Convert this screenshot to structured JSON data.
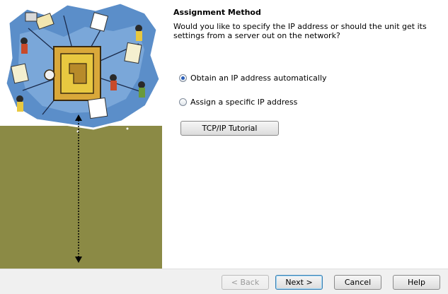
{
  "page": {
    "heading": "Assignment Method",
    "question": "Would you like to specify the IP address or should the unit get its settings from a server out on the network?"
  },
  "options": [
    {
      "label": "Obtain an IP address automatically",
      "checked": true
    },
    {
      "label": "Assign a specific IP address",
      "checked": false
    }
  ],
  "tutorial_button": "TCP/IP Tutorial",
  "footer": {
    "back": "< Back",
    "next": "Next >",
    "cancel": "Cancel",
    "help": "Help"
  },
  "colors": {
    "panel_olive": "#8b8a45",
    "map_blue": "#5b8ec9",
    "accent_yellow": "#e8c840"
  }
}
